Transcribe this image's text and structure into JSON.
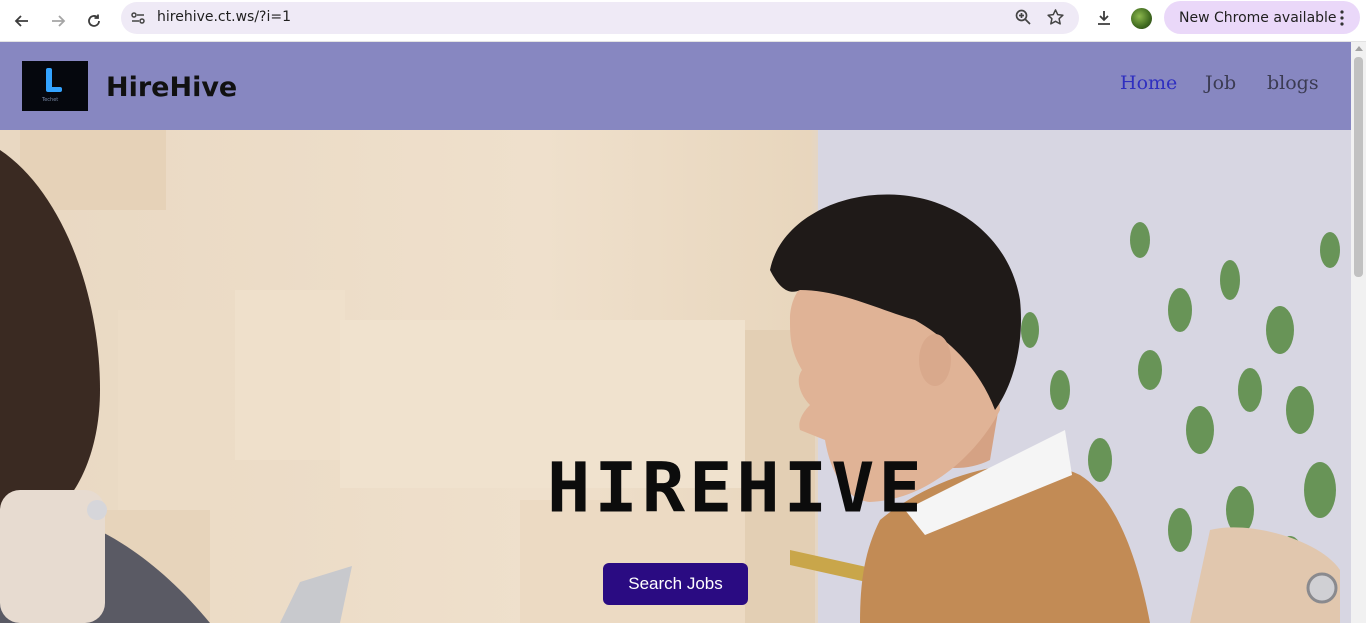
{
  "browser": {
    "url": "hirehive.ct.ws/?i=1",
    "update_label": "New Chrome available"
  },
  "header": {
    "logo_text": "Techet",
    "brand": "HireHive",
    "nav": [
      {
        "label": "Home",
        "active": true
      },
      {
        "label": "Job",
        "active": false
      },
      {
        "label": "blogs",
        "active": false
      }
    ]
  },
  "hero": {
    "title": "HIREHIVE",
    "cta_label": "Search Jobs"
  },
  "colors": {
    "header_bg": "#8787c1",
    "nav_active": "#2f2fc0",
    "cta_bg": "#2a0b82"
  }
}
